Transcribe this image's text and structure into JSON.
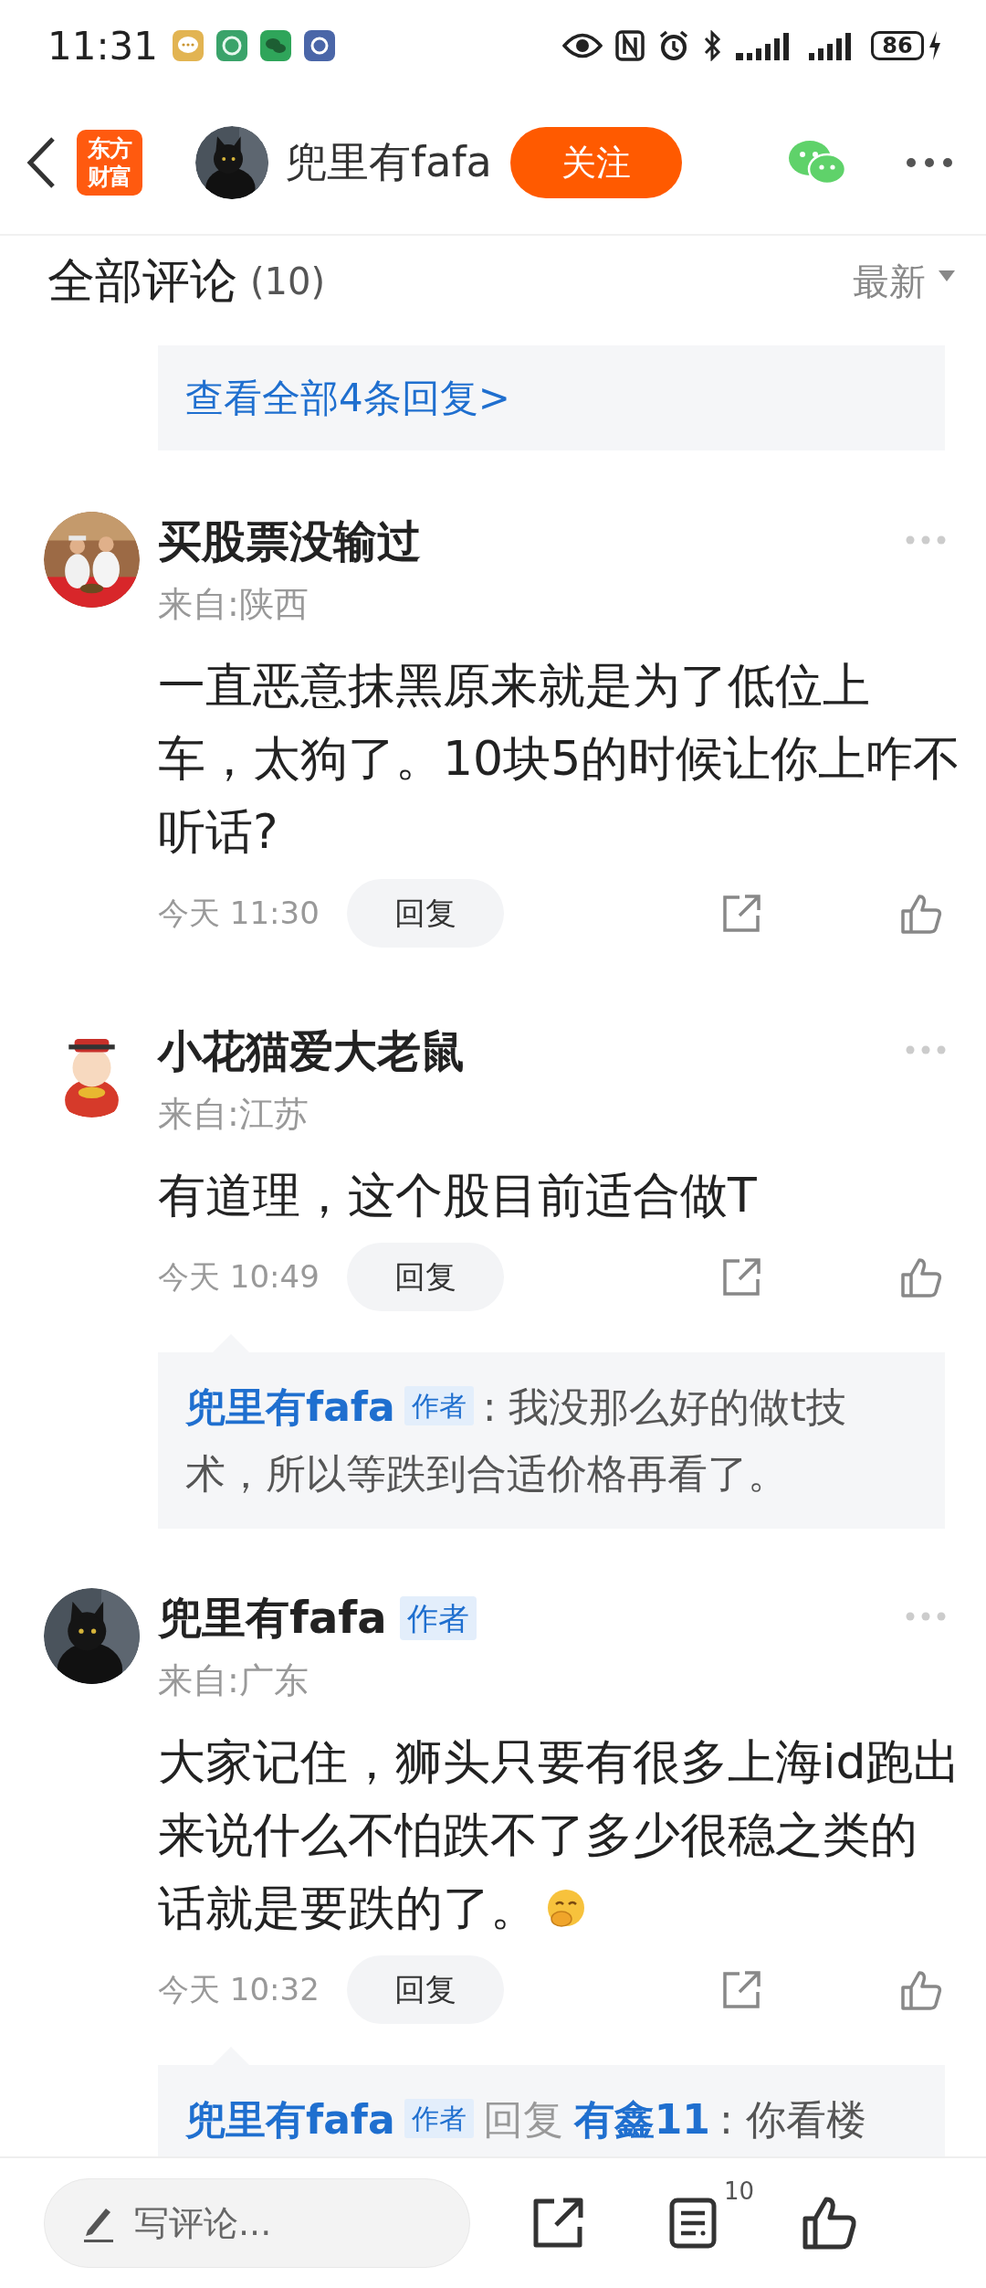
{
  "status_bar": {
    "time": "11:31",
    "battery": "86"
  },
  "header": {
    "app_logo": [
      "东方",
      "财富"
    ],
    "author": "兜里有fafa",
    "follow_button": "关注"
  },
  "comments_header": {
    "title": "全部评论",
    "count": "(10)",
    "sort": "最新"
  },
  "more_replies_link": "查看全部4条回复>",
  "comments": [
    {
      "name": "买股票没输过",
      "location": "来自:陕西",
      "text": "一直恶意抹黑原来就是为了低位上车，太狗了。10块5的时候让你上咋不听话?",
      "time": "今天 11:30",
      "reply_button": "回复"
    },
    {
      "name": "小花猫爱大老鼠",
      "location": "来自:江苏",
      "text": "有道理，这个股目前适合做T",
      "time": "今天 10:49",
      "reply_button": "回复",
      "replies": [
        {
          "name": "兜里有fafa",
          "badge": "作者",
          "text": ": 我没那么好的做t技术，所以等跌到合适价格再看了。"
        }
      ]
    },
    {
      "name": "兜里有fafa",
      "badge": "作者",
      "location": "来自:广东",
      "text": "大家记住，狮头只要有很多上海id跑出来说什么不怕跌不了多少很稳之类的话就是要跌的了。",
      "emoji": true,
      "time": "今天 10:32",
      "reply_button": "回复",
      "replies": [
        {
          "name": "兜里有fafa",
          "badge": "作者",
          "reply_word": "回复",
          "target": "有鑫11",
          "text": ": 你看楼"
        }
      ]
    }
  ],
  "bottom_bar": {
    "placeholder": "写评论...",
    "comment_count": "10"
  }
}
